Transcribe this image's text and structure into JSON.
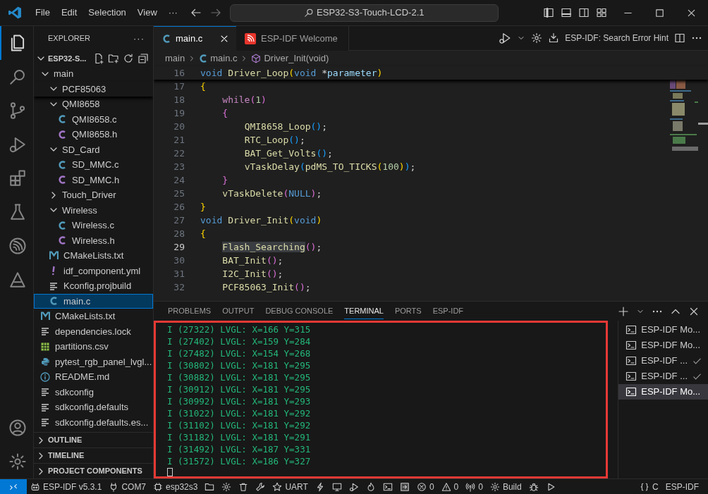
{
  "title_bar": {
    "menus": [
      "File",
      "Edit",
      "Selection",
      "View",
      "···"
    ],
    "search": "ESP32-S3-Touch-LCD-2.1"
  },
  "activity_bar": [
    {
      "kind": "files",
      "selected": true
    },
    {
      "kind": "search",
      "selected": false
    },
    {
      "kind": "branch",
      "selected": false
    },
    {
      "kind": "debug",
      "selected": false
    },
    {
      "kind": "extensions",
      "selected": false
    },
    {
      "kind": "flask",
      "selected": false
    },
    {
      "kind": "espressif",
      "selected": false
    },
    {
      "kind": "idf",
      "selected": false
    },
    {
      "kind": "account",
      "selected": false
    },
    {
      "kind": "settings",
      "selected": false
    }
  ],
  "sidebar": {
    "title": "EXPLORER",
    "more": "···",
    "root": {
      "label": "ESP32-S...",
      "expanded": true
    },
    "tree": [
      {
        "label": "main",
        "kind": "folder",
        "expanded": true,
        "selected": false,
        "children": [
          {
            "label": "PCF85063",
            "kind": "folder",
            "expanded": true,
            "selected": false
          },
          {
            "label": "QMI8658",
            "kind": "folder",
            "expanded": true,
            "selected": false,
            "children": [
              {
                "label": "QMI8658.c",
                "kind": "c",
                "selected": false
              },
              {
                "label": "QMI8658.h",
                "kind": "h",
                "selected": false
              }
            ]
          },
          {
            "label": "SD_Card",
            "kind": "folder",
            "expanded": true,
            "selected": false,
            "children": [
              {
                "label": "SD_MMC.c",
                "kind": "c",
                "selected": false
              },
              {
                "label": "SD_MMC.h",
                "kind": "h",
                "selected": false
              }
            ]
          },
          {
            "label": "Touch_Driver",
            "kind": "folder",
            "expanded": false,
            "selected": false
          },
          {
            "label": "Wireless",
            "kind": "folder",
            "expanded": true,
            "selected": false,
            "children": [
              {
                "label": "Wireless.c",
                "kind": "c",
                "selected": false
              },
              {
                "label": "Wireless.h",
                "kind": "h",
                "selected": false
              }
            ]
          },
          {
            "label": "CMakeLists.txt",
            "kind": "cmake",
            "selected": false
          },
          {
            "label": "idf_component.yml",
            "kind": "yml",
            "selected": false
          },
          {
            "label": "Kconfig.projbuild",
            "kind": "text",
            "selected": false
          },
          {
            "label": "main.c",
            "kind": "c",
            "selected": true
          }
        ]
      },
      {
        "label": "CMakeLists.txt",
        "kind": "cmake",
        "selected": false
      },
      {
        "label": "dependencies.lock",
        "kind": "text",
        "selected": false
      },
      {
        "label": "partitions.csv",
        "kind": "csv",
        "selected": false
      },
      {
        "label": "pytest_rgb_panel_lvgl...",
        "kind": "python",
        "selected": false
      },
      {
        "label": "README.md",
        "kind": "info",
        "selected": false
      },
      {
        "label": "sdkconfig",
        "kind": "text",
        "selected": false
      },
      {
        "label": "sdkconfig.defaults",
        "kind": "text",
        "selected": false
      },
      {
        "label": "sdkconfig.defaults.es...",
        "kind": "text",
        "selected": false
      }
    ],
    "sections": [
      {
        "label": "OUTLINE",
        "expanded": false
      },
      {
        "label": "TIMELINE",
        "expanded": false
      },
      {
        "label": "PROJECT COMPONENTS",
        "expanded": false
      }
    ]
  },
  "editor": {
    "tabs": [
      {
        "label": "main.c",
        "kind": "c",
        "selected": true
      },
      {
        "label": "ESP-IDF Welcome",
        "kind": "esp",
        "selected": false
      }
    ],
    "action_label": "ESP-IDF: Search Error Hint",
    "breadcrumb": [
      {
        "label": "main",
        "kind": "folder"
      },
      {
        "label": "main.c",
        "kind": "c"
      },
      {
        "label": "Driver_Init(void)",
        "kind": "symbol"
      }
    ],
    "lines": [
      {
        "number": "16",
        "current": false,
        "tokens": [
          {
            "text": "void",
            "kind": "type"
          },
          {
            "text": " Driver_Loop",
            "kind": "fn"
          },
          {
            "text": "(",
            "kind": "p1"
          },
          {
            "text": "void",
            "kind": "type"
          },
          {
            "text": " *",
            "kind": "txt"
          },
          {
            "text": "parameter",
            "kind": "param"
          },
          {
            "text": ")",
            "kind": "p1"
          }
        ]
      },
      {
        "number": "17",
        "current": false,
        "tokens": [
          {
            "text": "{",
            "kind": "p1"
          }
        ]
      },
      {
        "number": "18",
        "current": false,
        "tokens": [
          {
            "text": "    while",
            "kind": "kw"
          },
          {
            "text": "(",
            "kind": "p2"
          },
          {
            "text": "1",
            "kind": "num"
          },
          {
            "text": ")",
            "kind": "p2"
          }
        ]
      },
      {
        "number": "19",
        "current": false,
        "tokens": [
          {
            "text": "    {",
            "kind": "p2"
          }
        ]
      },
      {
        "number": "20",
        "current": false,
        "tokens": [
          {
            "text": "        QMI8658_Loop",
            "kind": "fn"
          },
          {
            "text": "()",
            "kind": "p3"
          },
          {
            "text": ";",
            "kind": "txt"
          }
        ]
      },
      {
        "number": "21",
        "current": false,
        "tokens": [
          {
            "text": "        RTC_Loop",
            "kind": "fn"
          },
          {
            "text": "()",
            "kind": "p3"
          },
          {
            "text": ";",
            "kind": "txt"
          }
        ]
      },
      {
        "number": "22",
        "current": false,
        "tokens": [
          {
            "text": "        BAT_Get_Volts",
            "kind": "fn"
          },
          {
            "text": "()",
            "kind": "p3"
          },
          {
            "text": ";",
            "kind": "txt"
          }
        ]
      },
      {
        "number": "23",
        "current": false,
        "tokens": [
          {
            "text": "        vTaskDelay",
            "kind": "fn"
          },
          {
            "text": "(",
            "kind": "p3"
          },
          {
            "text": "pdMS_TO_TICKS",
            "kind": "fn"
          },
          {
            "text": "(",
            "kind": "p1"
          },
          {
            "text": "100",
            "kind": "num"
          },
          {
            "text": ")",
            "kind": "p1"
          },
          {
            "text": ")",
            "kind": "p3"
          },
          {
            "text": ";",
            "kind": "txt"
          }
        ]
      },
      {
        "number": "24",
        "current": false,
        "tokens": [
          {
            "text": "    }",
            "kind": "p2"
          }
        ]
      },
      {
        "number": "25",
        "current": false,
        "tokens": [
          {
            "text": "    vTaskDelete",
            "kind": "fn"
          },
          {
            "text": "(",
            "kind": "p2"
          },
          {
            "text": "NULL",
            "kind": "macro"
          },
          {
            "text": ")",
            "kind": "p2"
          },
          {
            "text": ";",
            "kind": "txt"
          }
        ]
      },
      {
        "number": "26",
        "current": false,
        "tokens": [
          {
            "text": "}",
            "kind": "p1"
          }
        ]
      },
      {
        "number": "27",
        "current": false,
        "tokens": [
          {
            "text": "void",
            "kind": "type"
          },
          {
            "text": " Driver_Init",
            "kind": "fn"
          },
          {
            "text": "(",
            "kind": "p1"
          },
          {
            "text": "void",
            "kind": "type"
          },
          {
            "text": ")",
            "kind": "p1"
          }
        ]
      },
      {
        "number": "28",
        "current": false,
        "tokens": [
          {
            "text": "{",
            "kind": "p1"
          }
        ]
      },
      {
        "number": "29",
        "current": true,
        "tokens": [
          {
            "text": "    Flash_Searching",
            "kind": "fn"
          },
          {
            "text": "()",
            "kind": "p2"
          },
          {
            "text": ";",
            "kind": "txt"
          }
        ]
      },
      {
        "number": "30",
        "current": false,
        "tokens": [
          {
            "text": "    BAT_Init",
            "kind": "fn"
          },
          {
            "text": "()",
            "kind": "p2"
          },
          {
            "text": ";",
            "kind": "txt"
          }
        ]
      },
      {
        "number": "31",
        "current": false,
        "tokens": [
          {
            "text": "    I2C_Init",
            "kind": "fn"
          },
          {
            "text": "()",
            "kind": "p2"
          },
          {
            "text": ";",
            "kind": "txt"
          }
        ]
      },
      {
        "number": "32",
        "current": false,
        "tokens": [
          {
            "text": "    PCF85063_Init",
            "kind": "fn"
          },
          {
            "text": "()",
            "kind": "p2"
          },
          {
            "text": ";",
            "kind": "txt"
          }
        ]
      }
    ]
  },
  "panel": {
    "tabs": [
      {
        "label": "PROBLEMS",
        "selected": false
      },
      {
        "label": "OUTPUT",
        "selected": false
      },
      {
        "label": "DEBUG CONSOLE",
        "selected": false
      },
      {
        "label": "TERMINAL",
        "selected": true
      },
      {
        "label": "PORTS",
        "selected": false
      },
      {
        "label": "ESP-IDF",
        "selected": false
      }
    ],
    "terminal_lines": [
      "I (27322) LVGL: X=166 Y=315",
      "I (27402) LVGL: X=159 Y=284",
      "I (27482) LVGL: X=154 Y=268",
      "I (30802) LVGL: X=181 Y=295",
      "I (30882) LVGL: X=181 Y=295",
      "I (30912) LVGL: X=181 Y=295",
      "I (30992) LVGL: X=181 Y=293",
      "I (31022) LVGL: X=181 Y=292",
      "I (31102) LVGL: X=181 Y=292",
      "I (31182) LVGL: X=181 Y=291",
      "I (31492) LVGL: X=187 Y=331",
      "I (31572) LVGL: X=186 Y=327"
    ],
    "terminals": [
      {
        "label": "ESP-IDF Mo...",
        "done": false,
        "selected": false
      },
      {
        "label": "ESP-IDF Mo...",
        "done": false,
        "selected": false
      },
      {
        "label": "ESP-IDF ...",
        "done": true,
        "selected": false
      },
      {
        "label": "ESP-IDF ...",
        "done": true,
        "selected": false
      },
      {
        "label": "ESP-IDF Mo...",
        "done": false,
        "selected": true
      }
    ]
  },
  "status_bar": {
    "left": [
      {
        "kind": "remote"
      },
      {
        "kind": "robot",
        "text": "ESP-IDF v5.3.1"
      },
      {
        "kind": "plug",
        "text": "COM7"
      },
      {
        "kind": "chip",
        "text": "esp32s3"
      },
      {
        "kind": "folder"
      },
      {
        "kind": "gear"
      },
      {
        "kind": "trash"
      },
      {
        "kind": "wrench"
      },
      {
        "kind": "star",
        "text": "UART"
      },
      {
        "kind": "flash"
      },
      {
        "kind": "monitor"
      },
      {
        "kind": "debug"
      },
      {
        "kind": "flame"
      },
      {
        "kind": "terminal"
      },
      {
        "kind": "box"
      },
      {
        "kind": "error",
        "text": "0"
      },
      {
        "kind": "warning",
        "text": "0"
      },
      {
        "kind": "antenna",
        "text": "0"
      },
      {
        "kind": "gear",
        "text": "Build"
      },
      {
        "kind": "bug"
      },
      {
        "kind": "play"
      }
    ],
    "right": [
      {
        "kind": "braces",
        "text": "C"
      },
      {
        "kind": "none",
        "text": "ESP-IDF"
      }
    ]
  }
}
